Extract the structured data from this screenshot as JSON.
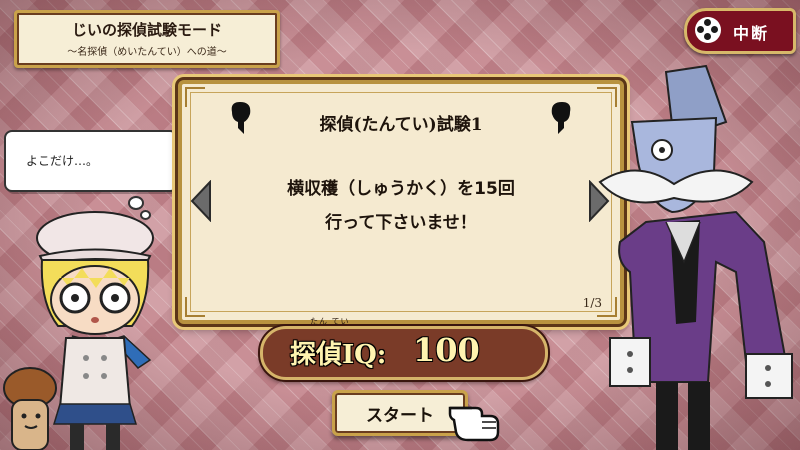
{
  "header": {
    "mode_title": "じいの探偵試験モード",
    "mode_subtitle": "～名探偵（めいたんてい）への道～"
  },
  "pause_button": {
    "label": "中断"
  },
  "speech_bubble": {
    "text": "よこだけ…。"
  },
  "exam_panel": {
    "title": "探偵(たんてい)試験1",
    "instruction_line1": "横収穫（しゅうかく）を15回",
    "instruction_line2": "行って下さいませ！",
    "page_indicator": "1/3"
  },
  "iq": {
    "ruby": "たん てい",
    "label": "探偵IQ:",
    "value": "100"
  },
  "start_button": {
    "label": "スタート"
  },
  "colors": {
    "background": "#c98f96",
    "panel": "#f5ead0",
    "gold_border": "#c9a24a",
    "pause_red": "#7a1020",
    "iq_bar": "#7a3b28"
  },
  "icons": {
    "panel_left": "glove-hand-icon",
    "panel_right": "glove-hand-icon",
    "nav_left": "arrow-left-icon",
    "nav_right": "arrow-right-icon",
    "pointer": "pointing-hand-icon",
    "pause": "controller-icon"
  }
}
